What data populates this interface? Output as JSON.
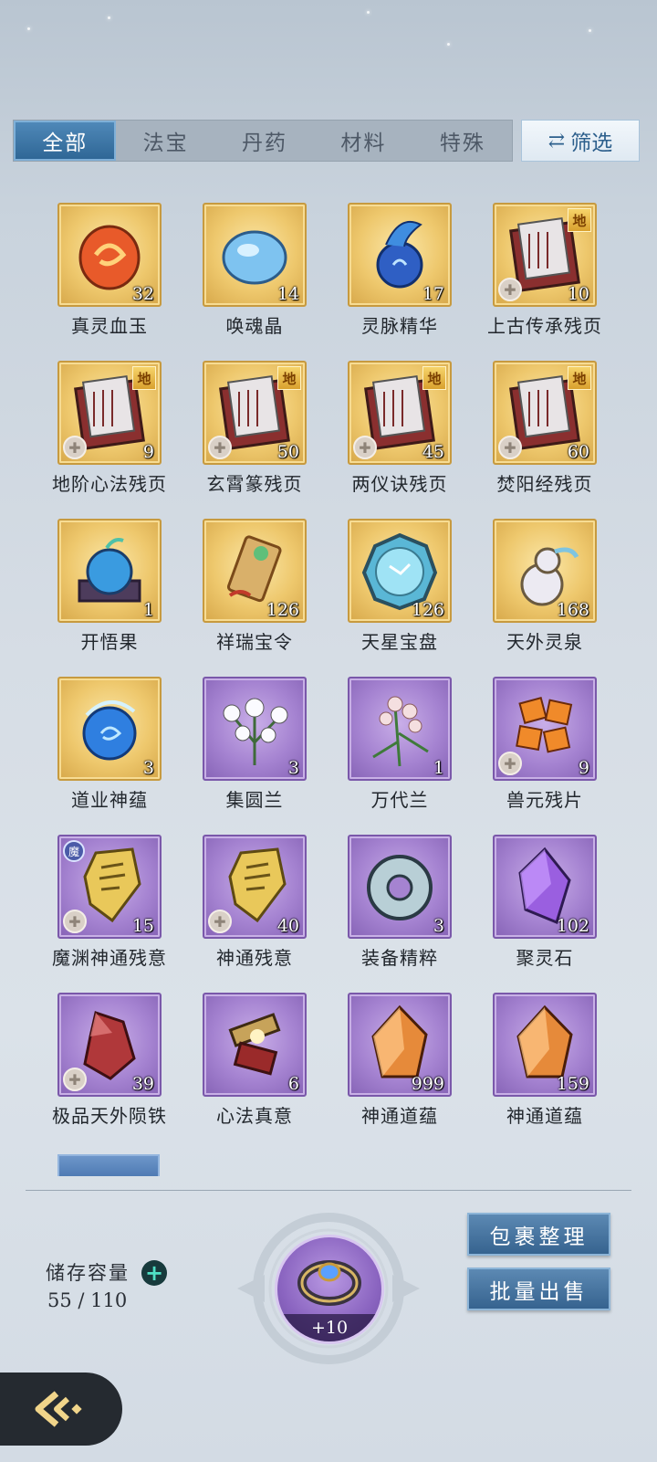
{
  "tabs": [
    {
      "label": "全部",
      "active": true
    },
    {
      "label": "法宝",
      "active": false
    },
    {
      "label": "丹药",
      "active": false
    },
    {
      "label": "材料",
      "active": false
    },
    {
      "label": "特殊",
      "active": false
    }
  ],
  "filter": {
    "icon": "swap-arrows-icon",
    "label": "筛选"
  },
  "items": [
    {
      "name": "真灵血玉",
      "count": "32",
      "rarity": "gold",
      "icon": "blood-jade-icon"
    },
    {
      "name": "唤魂晶",
      "count": "14",
      "rarity": "gold",
      "icon": "soul-crystal-icon"
    },
    {
      "name": "灵脉精华",
      "count": "17",
      "rarity": "gold",
      "icon": "spirit-essence-icon"
    },
    {
      "name": "上古传承残页",
      "count": "10",
      "rarity": "gold",
      "icon": "scroll-page-icon",
      "grade": "地",
      "fragment": true
    },
    {
      "name": "地阶心法残页",
      "count": "9",
      "rarity": "gold",
      "icon": "scroll-page-icon",
      "grade": "地",
      "fragment": true
    },
    {
      "name": "玄霄篆残页",
      "count": "50",
      "rarity": "gold",
      "icon": "scroll-page-icon",
      "grade": "地",
      "fragment": true
    },
    {
      "name": "两仪诀残页",
      "count": "45",
      "rarity": "gold",
      "icon": "scroll-page-icon",
      "grade": "地",
      "fragment": true
    },
    {
      "name": "焚阳经残页",
      "count": "60",
      "rarity": "gold",
      "icon": "scroll-page-icon",
      "grade": "地",
      "fragment": true
    },
    {
      "name": "开悟果",
      "count": "1",
      "rarity": "gold",
      "icon": "enlightenment-fruit-icon"
    },
    {
      "name": "祥瑞宝令",
      "count": "126",
      "rarity": "gold",
      "icon": "token-icon"
    },
    {
      "name": "天星宝盘",
      "count": "126",
      "rarity": "gold",
      "icon": "star-disk-icon"
    },
    {
      "name": "天外灵泉",
      "count": "168",
      "rarity": "gold",
      "icon": "spring-gourd-icon"
    },
    {
      "name": "道业神蕴",
      "count": "3",
      "rarity": "gold",
      "icon": "blue-orb-icon"
    },
    {
      "name": "集圆兰",
      "count": "3",
      "rarity": "purple",
      "icon": "white-orchid-icon"
    },
    {
      "name": "万代兰",
      "count": "1",
      "rarity": "purple",
      "icon": "pink-orchid-icon"
    },
    {
      "name": "兽元残片",
      "count": "9",
      "rarity": "purple",
      "icon": "beast-shard-icon",
      "fragment": true
    },
    {
      "name": "魔渊神通残意",
      "count": "15",
      "rarity": "purple",
      "icon": "gold-talisman-icon",
      "fragment": true,
      "tag": "魔"
    },
    {
      "name": "神通残意",
      "count": "40",
      "rarity": "purple",
      "icon": "gold-talisman-icon",
      "fragment": true
    },
    {
      "name": "装备精粹",
      "count": "3",
      "rarity": "purple",
      "icon": "jade-ring-icon"
    },
    {
      "name": "聚灵石",
      "count": "102",
      "rarity": "purple",
      "icon": "purple-crystal-icon"
    },
    {
      "name": "极品天外陨铁",
      "count": "39",
      "rarity": "purple",
      "icon": "red-meteor-icon",
      "fragment": true
    },
    {
      "name": "心法真意",
      "count": "6",
      "rarity": "purple",
      "icon": "broken-relic-icon"
    },
    {
      "name": "神通道蕴",
      "count": "999",
      "rarity": "purple",
      "icon": "amber-crystal-icon"
    },
    {
      "name": "神通道蕴",
      "count": "159",
      "rarity": "purple",
      "icon": "amber-crystal-icon"
    }
  ],
  "storage": {
    "label": "储存容量",
    "value": "55 / 110"
  },
  "ring": {
    "label": "+10",
    "icon": "storage-ring-icon"
  },
  "buttons": {
    "organize": "包裹整理",
    "bulk_sell": "批量出售"
  },
  "colors": {
    "gold_tile": "#eec86d",
    "purple_tile": "#a583d1",
    "tab_active": "#3f78a8",
    "button": "#4a77a2"
  }
}
